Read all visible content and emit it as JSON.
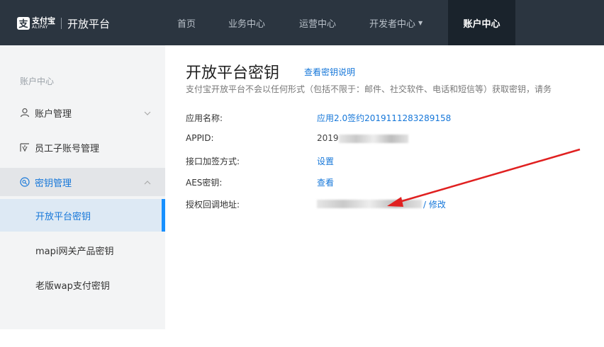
{
  "header": {
    "logo_cn": "支付宝",
    "logo_en": "ALIPAY",
    "title": "开放平台",
    "nav": [
      "首页",
      "业务中心",
      "运营中心",
      "开发者中心",
      "账户中心"
    ],
    "active_index": 4
  },
  "sidebar": {
    "header": "账户中心",
    "items": [
      {
        "label": "账户管理",
        "icon": "user-icon"
      },
      {
        "label": "员工子账号管理",
        "icon": "staff-icon"
      },
      {
        "label": "密钥管理",
        "icon": "key-icon"
      }
    ],
    "subitems": [
      "开放平台密钥",
      "mapi网关产品密钥",
      "老版wap支付密钥"
    ],
    "active_sub": 0
  },
  "main": {
    "title": "开放平台密钥",
    "doc_link": "查看密钥说明",
    "description": "支付宝开放平台不会以任何形式（包括不限于：邮件、社交软件、电话和短信等）获取密钥，请务",
    "fields": [
      {
        "label": "应用名称:",
        "value": "应用2.0签约2019111283289158"
      },
      {
        "label": "APPID:",
        "value": "2019"
      },
      {
        "label": "接口加签方式:",
        "value": "设置"
      },
      {
        "label": "AES密钥:",
        "value": "查看"
      },
      {
        "label": "授权回调地址:",
        "value": "/ 修改"
      }
    ]
  },
  "colors": {
    "topbar": "#2b3540",
    "accent": "#1677d9",
    "annotation_arrow": "#e02020"
  }
}
